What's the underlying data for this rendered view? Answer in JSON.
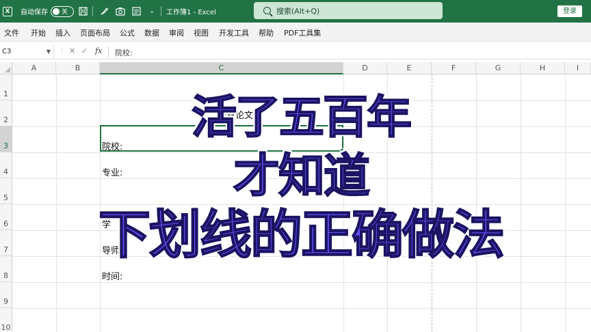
{
  "titlebar": {
    "logo": "X",
    "autosave_label": "自动保存",
    "toggle_state": "关",
    "doc_title": "工作簿1 - Excel",
    "search_placeholder": "搜索(Alt+Q)",
    "login_label": "登录",
    "icons": [
      "excel-logo",
      "save-icon",
      "brush-icon",
      "camera-icon",
      "form-icon",
      "dropdown-icon"
    ]
  },
  "menu": {
    "items": [
      "文件",
      "开始",
      "插入",
      "页面布局",
      "公式",
      "数据",
      "审阅",
      "视图",
      "开发工具",
      "帮助",
      "PDF工具集"
    ]
  },
  "formula_bar": {
    "name_box": "C3",
    "cancel": "✕",
    "confirm": "✓",
    "fx": "fx",
    "content": "院校:"
  },
  "sheet": {
    "columns": [
      "A",
      "B",
      "C",
      "D",
      "E",
      "F",
      "G",
      "H",
      "I"
    ],
    "selected_column": "C",
    "rows": [
      "1",
      "2",
      "3",
      "4",
      "5",
      "6",
      "7",
      "8",
      "9",
      "10"
    ],
    "selected_row": "3",
    "cells": {
      "c2": "毕业论文",
      "c3": "院校:",
      "c4": "专业:",
      "c6": "学",
      "c7": "导师:",
      "c8": "时间:"
    }
  },
  "overlay": {
    "line1": "活了五百年",
    "line2": "才知道",
    "line3": "下划线的正确做法"
  }
}
